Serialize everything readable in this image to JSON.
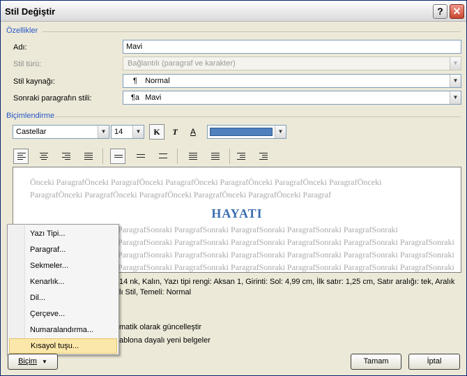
{
  "window": {
    "title": "Stil Değiştir",
    "help": "?",
    "close": "✕"
  },
  "properties": {
    "group": "Özellikler",
    "name_label": "Adı:",
    "name_value": "Mavi",
    "type_label": "Stil türü:",
    "type_value": "Bağlantılı (paragraf ve karakter)",
    "based_label": "Stil kaynağı:",
    "based_value": "Normal",
    "based_symbol": "¶",
    "next_label": "Sonraki paragrafın stili:",
    "next_value": "Mavi",
    "next_symbol": "¶a"
  },
  "formatting": {
    "group": "Biçimlendirme",
    "font": "Castellar",
    "size": "14",
    "bold": "K",
    "italic": "T",
    "underline": "A",
    "color": "#4f81bd"
  },
  "preview": {
    "prev_line1": "Önceki ParagrafÖnceki ParagrafÖnceki ParagrafÖnceki ParagrafÖnceki ParagrafÖnceki ParagrafÖnceki",
    "prev_line2": "ParagrafÖnceki ParagrafÖnceki ParagrafÖnceki ParagrafÖnceki ParagrafÖnceki Paragraf",
    "title": "HAYATI",
    "next_line1": "ParagrafSonraki ParagrafSonraki ParagrafSonraki ParagrafSonraki ParagrafSonraki",
    "next_line2": "ParagrafSonraki ParagrafSonraki ParagrafSonraki ParagrafSonraki ParagrafSonraki ParagrafSonraki",
    "next_line3": "ParagrafSonraki ParagrafSonraki ParagrafSonraki ParagrafSonraki ParagrafSonraki ParagrafSonraki",
    "next_line4": "ParagrafSonraki ParagrafSonraki ParagrafSonraki ParagrafSonraki ParagrafSonraki ParagrafSonraki"
  },
  "description": {
    "line1": "14 nk, Kalın, Yazı tipi rengi: Aksan 1, Girinti: Sol:  4,99 cm, İlk satır:  1,25 cm, Satır aralığı:  tek, Aralık",
    "line2": "lı Stil, Temeli: Normal"
  },
  "options": {
    "auto_update": "matik olarak güncelleştir",
    "new_docs": "ablona dayalı yeni belgeler"
  },
  "context_menu": {
    "items": [
      "Yazı Tipi...",
      "Paragraf...",
      "Sekmeler...",
      "Kenarlık...",
      "Dil...",
      "Çerçeve...",
      "Numaralandırma...",
      "Kısayol tuşu..."
    ],
    "highlighted_index": 7
  },
  "buttons": {
    "format": "Biçim",
    "ok": "Tamam",
    "cancel": "İptal"
  }
}
